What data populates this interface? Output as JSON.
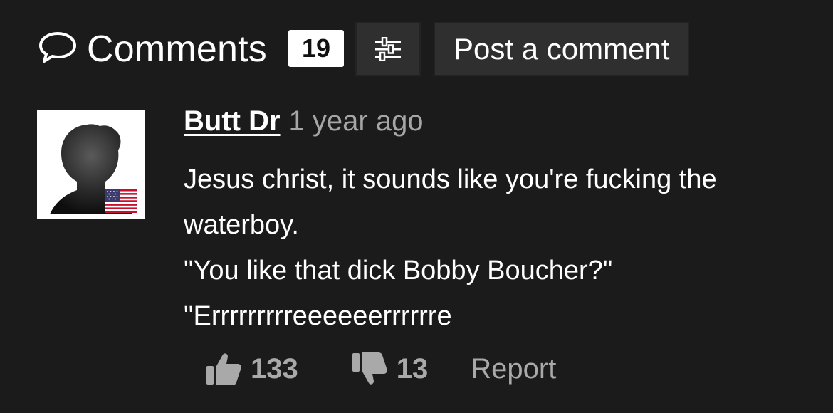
{
  "header": {
    "title": "Comments",
    "count": "19",
    "post_button_label": "Post a comment"
  },
  "comment": {
    "username": "Butt Dr",
    "timestamp": "1 year ago",
    "country": "United States",
    "text_lines": [
      "Jesus christ, it sounds like you're fucking the",
      "waterboy.",
      "\"You like that dick Bobby Boucher?\"",
      "\"Errrrrrrrreeeeeerrrrrre"
    ],
    "likes": "133",
    "dislikes": "13",
    "report_label": "Report"
  },
  "colors": {
    "background": "#1b1b1b",
    "button_bg": "#2f2f2f",
    "muted_text": "#a9a9a9",
    "badge_bg": "#ffffff"
  },
  "icons": {
    "comments": "speech-bubble-icon",
    "filter": "sliders-icon",
    "like": "thumbs-up-icon",
    "dislike": "thumbs-down-icon",
    "flag": "us-flag-icon"
  }
}
